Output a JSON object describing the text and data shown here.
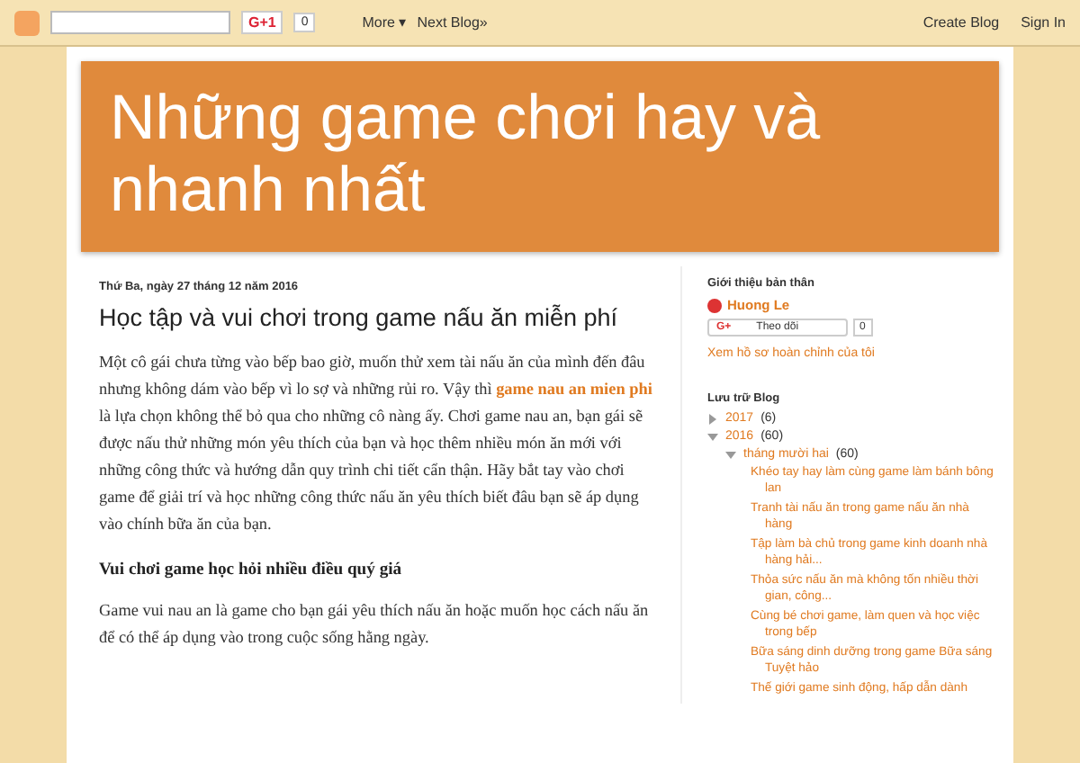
{
  "navbar": {
    "gplus": {
      "label": "G+1",
      "count": "0"
    },
    "more": "More",
    "more_caret": "▾",
    "next_blog": "Next Blog»",
    "create_blog": "Create Blog",
    "sign_in": "Sign In"
  },
  "header": {
    "title": "Những game chơi hay và nhanh nhất"
  },
  "post": {
    "date": "Thứ Ba, ngày 27 tháng 12 năm 2016",
    "title": "Học tập và vui chơi trong game nấu ăn miễn phí",
    "paragraph_before_link": "Một cô gái chưa từng vào bếp bao giờ, muốn thử xem tài nấu ăn của mình đến đâu nhưng không dám vào bếp vì lo sợ và những rủi ro. Vậy thì",
    "link": "game nau an mien phi",
    "paragraph_after_link": "là lựa chọn không thể bỏ qua cho những cô nàng ấy. Chơi game nau an, bạn gái sẽ được nấu thử những món yêu thích của bạn và học thêm nhiều món ăn mới  với những công thức và hướng dẫn quy trình chi tiết cẩn thận. Hãy bắt tay vào chơi game để giải trí và học những công thức nấu ăn yêu thích biết đâu bạn sẽ áp dụng vào chính bữa ăn của bạn.",
    "subheading": "Vui chơi game học hỏi nhiều điều quý giá",
    "paragraph_2": "Game vui nau an là game cho bạn gái yêu thích nấu ăn hoặc muốn học cách nấu ăn để có thể áp dụng vào trong cuộc sống hằng ngày."
  },
  "sidebar": {
    "about": {
      "heading": "Giới thiệu bản thân",
      "name": "Huong Le",
      "follow_icon": "G+",
      "follow_label": "Theo dõi",
      "follow_count": "0",
      "profile_link": "Xem hồ sơ hoàn chỉnh của tôi"
    },
    "archive": {
      "heading": "Lưu trữ Blog",
      "items": [
        {
          "label": "2017",
          "count": "(6)",
          "expanded": false
        },
        {
          "label": "2016",
          "count": "(60)",
          "expanded": true,
          "children": [
            {
              "label": "tháng mười hai",
              "count": "(60)",
              "expanded": true,
              "posts": [
                "Khéo tay hay làm cùng game làm bánh bông lan",
                "Tranh tài nấu ăn trong game nấu ăn nhà hàng",
                "Tập làm bà chủ trong game kinh doanh nhà hàng hải...",
                "Thỏa sức nấu ăn mà không tốn nhiều thời gian, công...",
                "Cùng bé chơi game, làm quen và học việc trong bếp",
                "Bữa sáng dinh dưỡng trong game Bữa sáng Tuyệt hảo",
                "Thế giới game sinh động, hấp dẫn dành"
              ]
            }
          ]
        }
      ]
    }
  }
}
